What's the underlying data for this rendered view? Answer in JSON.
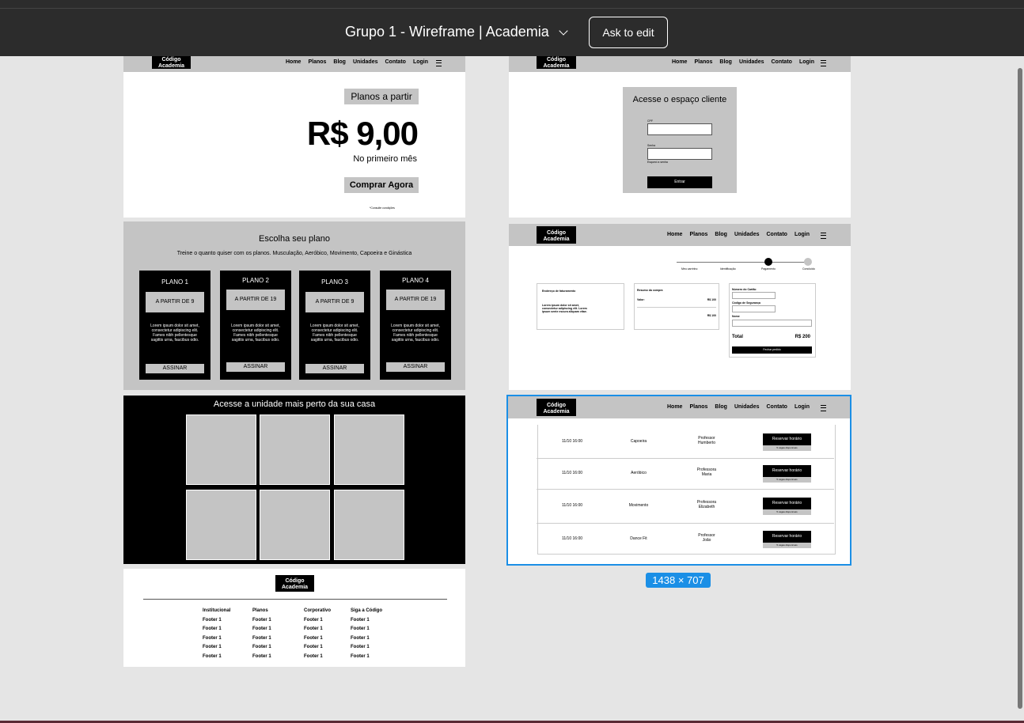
{
  "topbar": {
    "file_title": "Grupo 1 - Wireframe | Academia",
    "ask_to_edit": "Ask to edit"
  },
  "colors": {
    "toolbar_bg": "#2c2c2c",
    "canvas_bg": "#e5e5e5",
    "wire_gray": "#c4c4c4",
    "selection_blue": "#1b8fe6"
  },
  "nav": {
    "logo_line1": "Código",
    "logo_line2": "Academia",
    "links": [
      "Home",
      "Planos",
      "Blog",
      "Unidades",
      "Contato",
      "Login"
    ]
  },
  "hero": {
    "plans_from": "Planos a partir",
    "price": "R$ 9,00",
    "first_month": "No primeiro mês",
    "buy_now": "Comprar Agora",
    "conditions": "*Consulte condições"
  },
  "plans": {
    "title": "Escolha seu plano",
    "subtitle": "Treine o quanto quiser com os planos. Musculação, Aeróbico, Movimento, Capoeira e Ginástica",
    "items": [
      {
        "name": "PLANO 1",
        "price": "A PARTIR DE 9",
        "desc": "Lorem ipsum dolor sit amet, consectetur adipiscing elit. Fames nibh pellentesque sagittis urna, faucibus odio.",
        "cta": "ASSINAR"
      },
      {
        "name": "PLANO 2",
        "price": "A PARTIR DE 19",
        "desc": "Lorem ipsum dolor sit amet, consectetur adipiscing elit. Fames nibh pellentesque sagittis urna, faucibus odio.",
        "cta": "ASSINAR"
      },
      {
        "name": "PLANO 3",
        "price": "A PARTIR DE 9",
        "desc": "Lorem ipsum dolor sit amet, consectetur adipiscing elit. Fames nibh pellentesque sagittis urna, faucibus odio.",
        "cta": "ASSINAR"
      },
      {
        "name": "PLANO 4",
        "price": "A PARTIR DE 19",
        "desc": "Lorem ipsum dolor sit amet, consectetur adipiscing elit. Fames nibh pellentesque sagittis urna, faucibus odio.",
        "cta": "ASSINAR"
      }
    ]
  },
  "units": {
    "title": "Acesse a unidade mais perto da sua casa"
  },
  "footer": {
    "columns": [
      {
        "title": "Institucional",
        "items": [
          "Footer 1",
          "Footer 1",
          "Footer 1",
          "Footer 1",
          "Footer 1"
        ]
      },
      {
        "title": "Planos",
        "items": [
          "Footer 1",
          "Footer 1",
          "Footer 1",
          "Footer 1",
          "Footer 1"
        ]
      },
      {
        "title": "Corporativo",
        "items": [
          "Footer 1",
          "Footer 1",
          "Footer 1",
          "Footer 1",
          "Footer 1"
        ]
      },
      {
        "title": "Siga a Código",
        "items": [
          "Footer 1",
          "Footer 1",
          "Footer 1",
          "Footer 1",
          "Footer 1"
        ]
      }
    ]
  },
  "login": {
    "title": "Acesse o espaço cliente",
    "cpf_label": "CPF",
    "password_label": "Senha",
    "forgot": "Esqueci a senha",
    "submit": "Entrar"
  },
  "checkout": {
    "steps": [
      "Meu carrinho",
      "Identificação",
      "Pagamento",
      "Concluído"
    ],
    "billing_title": "Endereço de faturamento",
    "billing_text": "Lorem ipsum dolor sit amet, consectetur adipiscing elit. Lorem ipsum sente escura aliquam vitae.",
    "summary_title": "Resumo da compra",
    "summary_label": "Valor:",
    "summary_value1": "R$ 100",
    "summary_value2": "R$ 100",
    "card_number": "Número do Cartão",
    "security_code": "Código de Segurança",
    "name": "Nome",
    "total_label": "Total",
    "total_value": "R$ 200",
    "finish": "Fechar pedido"
  },
  "schedule": {
    "rows": [
      {
        "date": "11/10 16:00",
        "class": "Capoeira",
        "teacher_l1": "Professor",
        "teacher_l2": "Humberto",
        "button": "Reservar horário",
        "spots": "5 vagas disponíveis"
      },
      {
        "date": "11/10 16:00",
        "class": "Aeróbico",
        "teacher_l1": "Professora",
        "teacher_l2": "Maria",
        "button": "Reservar horário",
        "spots": "5 vagas disponíveis"
      },
      {
        "date": "11/10 16:00",
        "class": "Movimento",
        "teacher_l1": "Professora",
        "teacher_l2": "Elizabeth",
        "button": "Reservar horário",
        "spots": "5 vagas disponíveis"
      },
      {
        "date": "11/10 16:00",
        "class": "Dance Fit",
        "teacher_l1": "Professor",
        "teacher_l2": "João",
        "button": "Reservar horário",
        "spots": "5 vagas disponíveis"
      }
    ]
  },
  "selection": {
    "size_label": "1438 × 707"
  }
}
